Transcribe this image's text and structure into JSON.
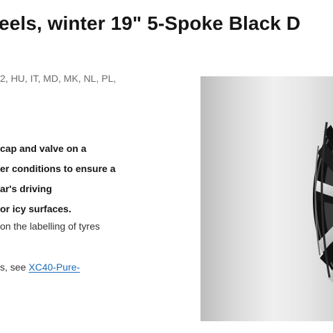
{
  "product": {
    "title": "eels, winter 19\" 5-Spoke Black D",
    "markets_line": "2, HU, IT, MD, MK, NL, PL,",
    "description_bold": [
      "cap and valve on a",
      "er conditions to ensure a",
      "ar's driving",
      "or icy surfaces."
    ],
    "labelling_line": "on the labelling of tyres",
    "see_prefix": "s, see ",
    "see_link": "XC40-Pure-"
  },
  "image": {
    "subject": "19-inch 5-spoke black diamond cut wheel",
    "colors": {
      "spoke_dark": "#1e1e1e",
      "spoke_silver": "#c9c9c9",
      "background": "#e6e6e6"
    }
  }
}
